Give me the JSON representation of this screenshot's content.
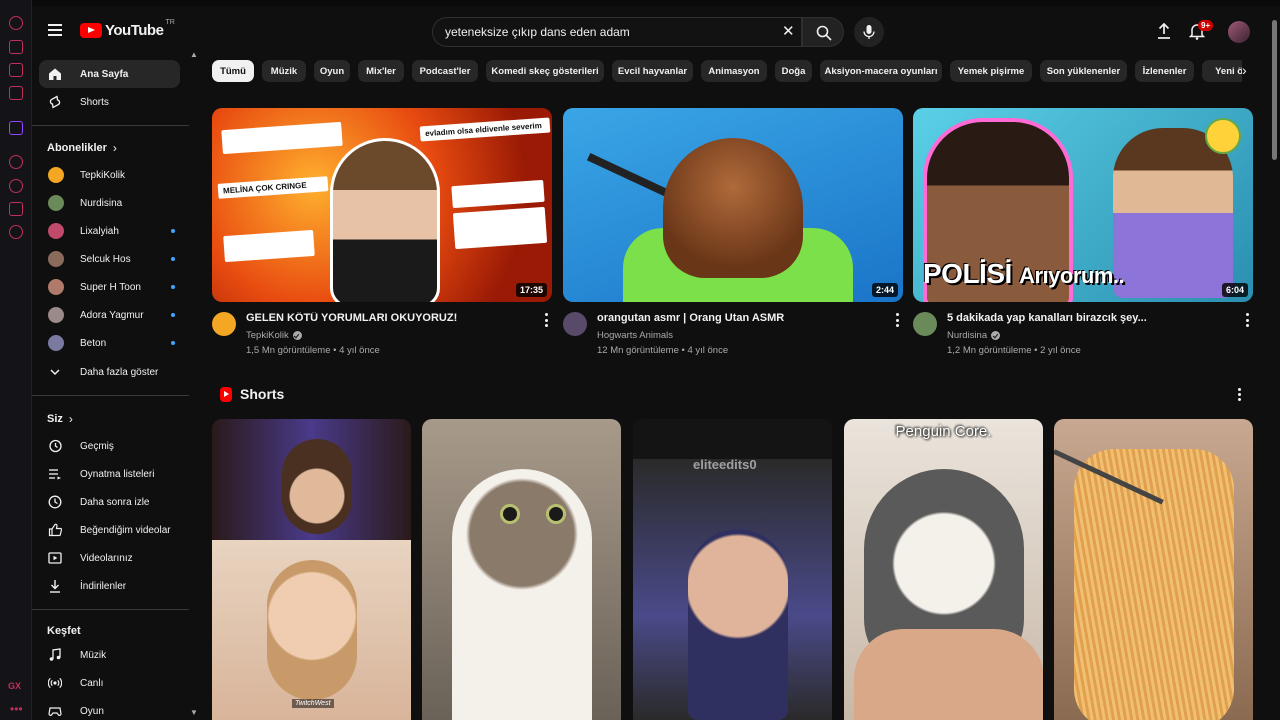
{
  "header": {
    "logo_text": "YouTube",
    "logo_region": "TR",
    "search_value": "yeteneksize çıkıp dans eden adam",
    "notifications_badge": "9+"
  },
  "sidebar": {
    "main": [
      {
        "label": "Ana Sayfa",
        "icon": "home-icon",
        "active": true
      },
      {
        "label": "Shorts",
        "icon": "shorts-icon",
        "active": false
      }
    ],
    "subscriptions_title": "Abonelikler",
    "subscriptions": [
      {
        "label": "TepkiKolik",
        "color": "#f5a623",
        "live": false
      },
      {
        "label": "Nurdisina",
        "color": "#6a8a5a",
        "live": false
      },
      {
        "label": "Lixalyiah",
        "color": "#c04a6a",
        "live": true
      },
      {
        "label": "Selcuk Hos",
        "color": "#8a6a5a",
        "live": true
      },
      {
        "label": "Super H Toon",
        "color": "#b07a6a",
        "live": true
      },
      {
        "label": "Adora Yagmur",
        "color": "#9a8a8a",
        "live": true
      },
      {
        "label": "Beton",
        "color": "#7a7aa0",
        "live": true
      }
    ],
    "show_more_label": "Daha fazla göster",
    "you_title": "Siz",
    "you_items": [
      {
        "label": "Geçmiş",
        "icon": "history-icon"
      },
      {
        "label": "Oynatma listeleri",
        "icon": "playlist-icon"
      },
      {
        "label": "Daha sonra izle",
        "icon": "watch-later-icon"
      },
      {
        "label": "Beğendiğim videolar",
        "icon": "like-icon"
      },
      {
        "label": "Videolarınız",
        "icon": "your-videos-icon"
      },
      {
        "label": "İndirilenler",
        "icon": "download-icon"
      }
    ],
    "explore_title": "Keşfet",
    "explore_items": [
      {
        "label": "Müzik",
        "icon": "music-icon"
      },
      {
        "label": "Canlı",
        "icon": "live-icon"
      },
      {
        "label": "Oyun",
        "icon": "gaming-icon"
      }
    ]
  },
  "chips": [
    "Tümü",
    "Müzik",
    "Oyun",
    "Mix'ler",
    "Podcast'ler",
    "Komedi skeç gösterileri",
    "Evcil hayvanlar",
    "Animasyon",
    "Doğa",
    "Aksiyon-macera oyunları",
    "Yemek pişirme",
    "Son yüklenenler",
    "İzlenenler",
    "Yeni ön"
  ],
  "videos": [
    {
      "title": "GELEN KÖTÜ YORUMLARI OKUYORUZ!",
      "channel": "TepkiKolik",
      "verified": true,
      "meta": "1,5 Mn görüntüleme • 4 yıl önce",
      "duration": "17:35",
      "avatar_color": "#f5a623",
      "thumb_texts": [
        "evladım olsa eldivenle severim",
        "MELİNA ÇOK CRINGE"
      ]
    },
    {
      "title": "orangutan asmr | Orang Utan ASMR",
      "channel": "Hogwarts Animals",
      "verified": false,
      "meta": "12 Mn görüntüleme • 4 yıl önce",
      "duration": "2:44",
      "avatar_color": "#5a4a6a"
    },
    {
      "title": "5 dakikada yap kanalları birazcık şey...",
      "channel": "Nurdisina",
      "verified": true,
      "meta": "1,2 Mn görüntüleme • 2 yıl önce",
      "duration": "6:04",
      "avatar_color": "#6a8a5a",
      "thumb_caption_big": "POLİSİ",
      "thumb_caption_small": "Arıyorum.."
    }
  ],
  "shorts": {
    "title": "Shorts",
    "items": [
      {
        "overlay": "TwitchWest"
      },
      {
        "overlay": ""
      },
      {
        "overlay": "eliteedits0"
      },
      {
        "overlay": "Penguin Core."
      },
      {
        "overlay": ""
      }
    ]
  }
}
